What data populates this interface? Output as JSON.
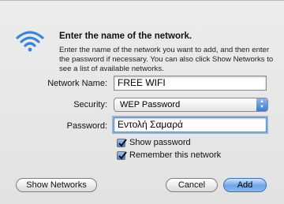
{
  "dialog": {
    "heading": "Enter the name of the network.",
    "description": "Enter the name of the network you want to add, and then enter the password if necessary. You can also click Show Networks to see a list of available networks."
  },
  "form": {
    "network_name_label": "Network Name:",
    "network_name_value": "FREE WIFI",
    "security_label": "Security:",
    "security_value": "WEP Password",
    "password_label": "Password:",
    "password_value": "Εντολή Σαμαρά",
    "show_password_label": "Show password",
    "show_password_checked": true,
    "remember_label": "Remember this network",
    "remember_checked": true
  },
  "buttons": {
    "show_networks": "Show Networks",
    "cancel": "Cancel",
    "add": "Add"
  },
  "colors": {
    "wifi_icon": "#3b82d8",
    "accent": "#4a86d6"
  }
}
